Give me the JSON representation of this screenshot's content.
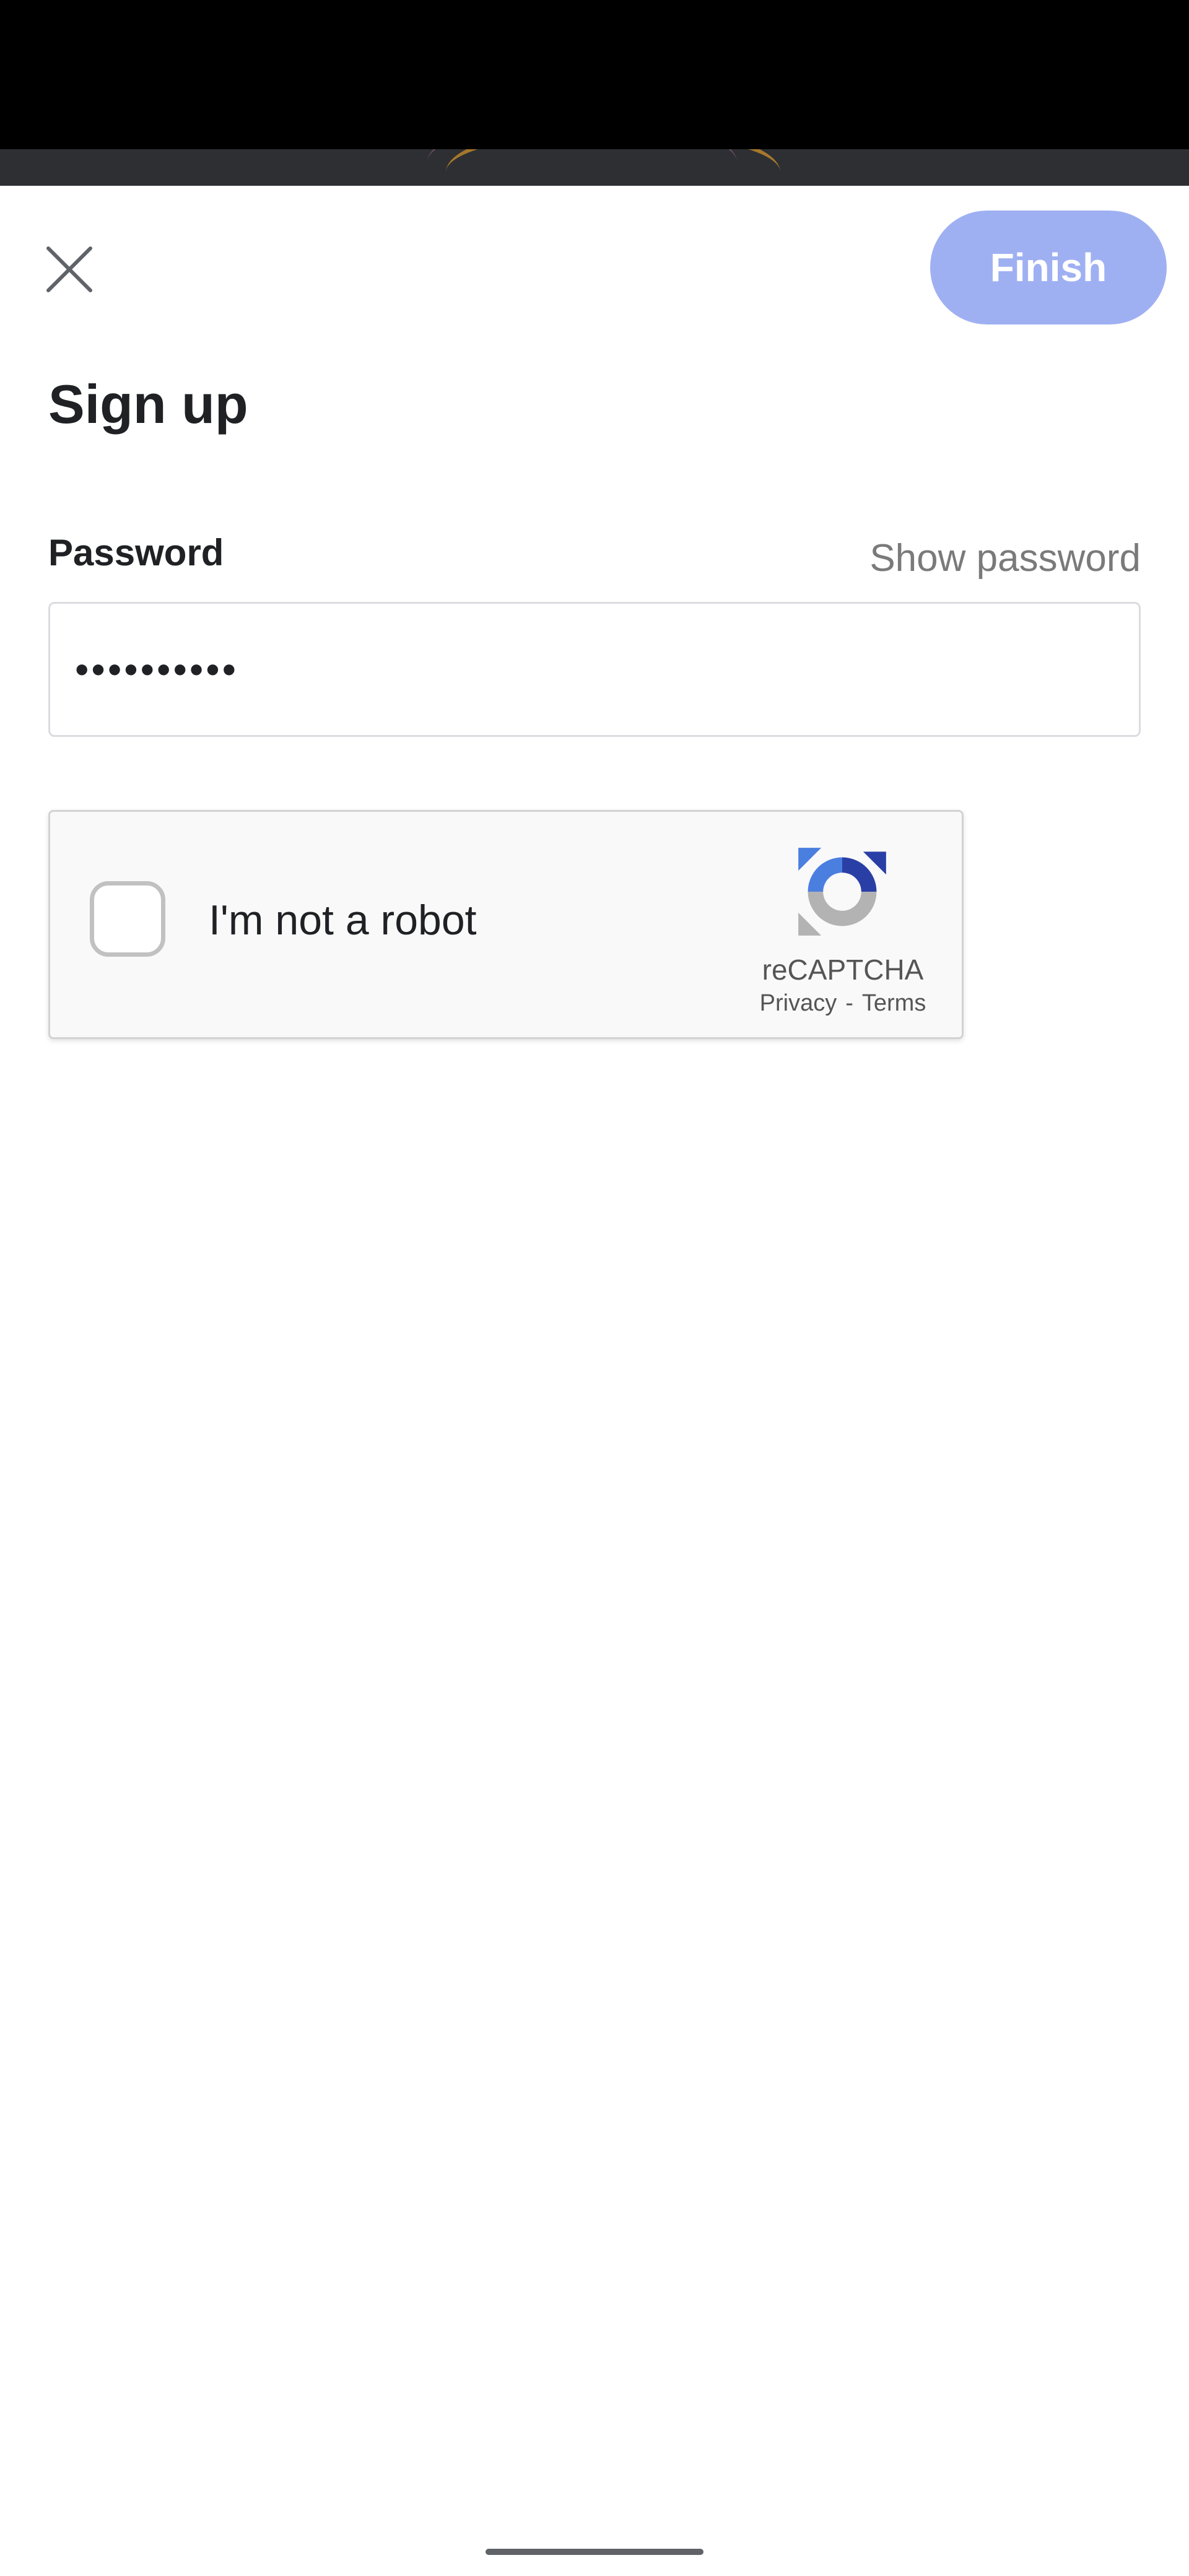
{
  "header": {
    "finish_label": "Finish"
  },
  "page": {
    "title": "Sign up"
  },
  "password": {
    "label": "Password",
    "show_password_label": "Show password",
    "value": "••••••••••"
  },
  "recaptcha": {
    "checkbox_label": "I'm not a robot",
    "brand": "reCAPTCHA",
    "privacy_label": "Privacy",
    "separator": "-",
    "terms_label": "Terms"
  },
  "colors": {
    "finish_button_bg": "#9fb0f2",
    "recaptcha_blue": "#4a7fe0",
    "recaptcha_dark_blue": "#2a3fa6",
    "recaptcha_gray": "#b3b3b3"
  }
}
